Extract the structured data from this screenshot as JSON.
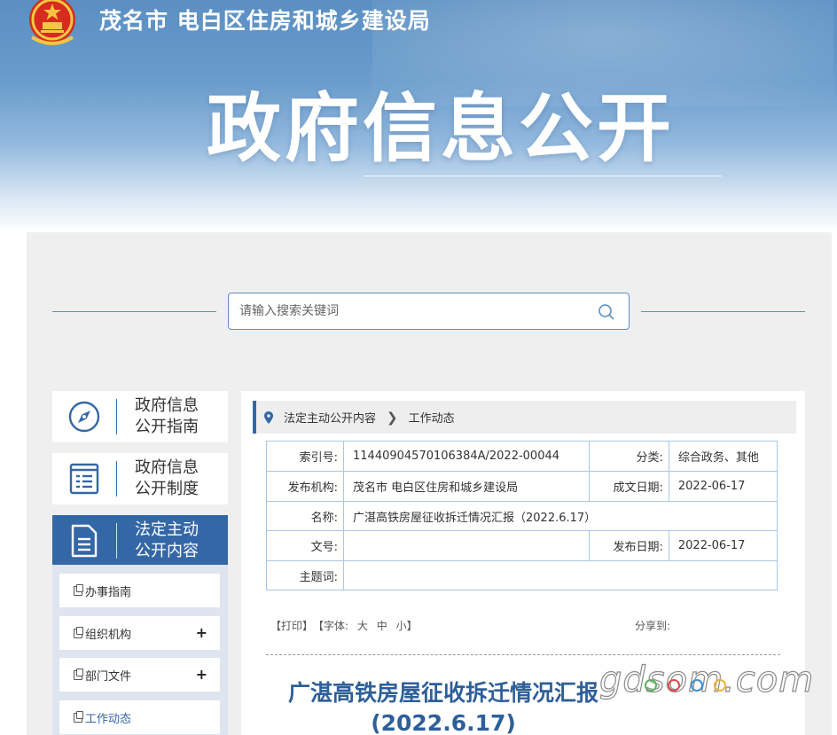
{
  "header": {
    "org_name": "茂名市 电白区住房和城乡建设局",
    "big_title": "政府信息公开"
  },
  "search": {
    "placeholder": "请输入搜索关键词"
  },
  "nav": {
    "cards": [
      {
        "label": "政府信息\n公开指南",
        "icon": "compass-icon"
      },
      {
        "label": "政府信息\n公开制度",
        "icon": "list-document-icon"
      },
      {
        "label": "法定主动\n公开内容",
        "icon": "document-icon"
      }
    ],
    "sub_items": [
      {
        "label": "办事指南"
      },
      {
        "label": "组织机构",
        "expand": "+"
      },
      {
        "label": "部门文件",
        "expand": "+"
      },
      {
        "label": "工作动态"
      }
    ]
  },
  "breadcrumb": {
    "parent": "法定主动公开内容",
    "current": "工作动态"
  },
  "meta": {
    "index_label": "索引号:",
    "index_value": "11440904570106384A/2022-00044",
    "category_label": "分类:",
    "category_value": "综合政务、其他",
    "publisher_label": "发布机构:",
    "publisher_value": "茂名市 电白区住房和城乡建设局",
    "created_label": "成文日期:",
    "created_value": "2022-06-17",
    "name_label": "名称:",
    "name_value": "广湛高铁房屋征收拆迁情况汇报（2022.6.17）",
    "doc_no_label": "文号:",
    "doc_no_value": "",
    "publish_date_label": "发布日期:",
    "publish_date_value": "2022-06-17",
    "subject_label": "主题词:",
    "subject_value": ""
  },
  "tools": {
    "print": "【打印】",
    "font_label": "【字体:",
    "font_large": "大",
    "font_medium": "中",
    "font_small": "小】",
    "share_label": "分享到:"
  },
  "article": {
    "title_line1": "广湛高铁房屋征收拆迁情况汇报",
    "title_line2": "(2022.6.17)"
  },
  "watermark": {
    "text": "gdsom.com"
  },
  "colors": {
    "primary": "#3467a6",
    "title_blue": "#2e5f99",
    "border_blue": "#a9c6e2",
    "panel_gray": "#efefef"
  }
}
